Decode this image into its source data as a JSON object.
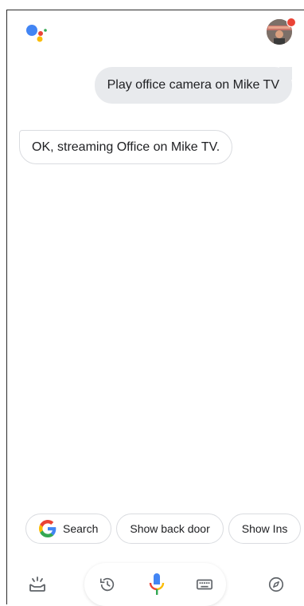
{
  "conversation": {
    "user_query": "Play office camera on Mike TV",
    "assistant_reply": "OK, streaming Office on Mike TV."
  },
  "suggestions": [
    {
      "label": "Search",
      "icon": "google-g-icon"
    },
    {
      "label": "Show back door"
    },
    {
      "label": "Show Ins"
    }
  ],
  "bottom_bar": {
    "icons": [
      "snapshot-icon",
      "history-icon",
      "microphone-icon",
      "keyboard-icon",
      "explore-compass-icon"
    ]
  },
  "colors": {
    "blue": "#4285F4",
    "red": "#EA4335",
    "yellow": "#FBBC05",
    "green": "#34A853",
    "user_bubble": "#E8EAED",
    "chip_border": "#DADCE0"
  }
}
